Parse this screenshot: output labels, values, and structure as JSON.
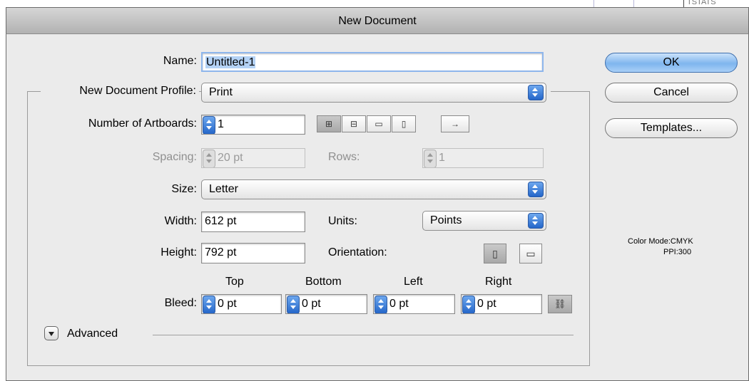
{
  "dialog": {
    "title": "New Document"
  },
  "background": {
    "corner_text": "TSTATS"
  },
  "name": {
    "label": "Name:",
    "value": "Untitled-1"
  },
  "profile": {
    "label": "New Document Profile:",
    "value": "Print"
  },
  "artboards": {
    "label": "Number of Artboards:",
    "value": "1",
    "layout_icons": [
      "grid-by-row-icon",
      "grid-by-column-icon",
      "arrange-by-row-icon",
      "arrange-by-column-icon",
      "left-to-right-icon"
    ]
  },
  "spacing": {
    "label": "Spacing:",
    "value": "20 pt"
  },
  "rows": {
    "label": "Rows:",
    "value": "1"
  },
  "size": {
    "label": "Size:",
    "value": "Letter"
  },
  "width": {
    "label": "Width:",
    "value": "612 pt"
  },
  "height": {
    "label": "Height:",
    "value": "792 pt"
  },
  "units": {
    "label": "Units:",
    "value": "Points"
  },
  "orientation": {
    "label": "Orientation:",
    "selected": "portrait"
  },
  "bleed": {
    "label": "Bleed:",
    "top": {
      "label": "Top",
      "value": "0 pt"
    },
    "bottom": {
      "label": "Bottom",
      "value": "0 pt"
    },
    "left": {
      "label": "Left",
      "value": "0 pt"
    },
    "right": {
      "label": "Right",
      "value": "0 pt"
    }
  },
  "advanced": {
    "label": "Advanced"
  },
  "buttons": {
    "ok": "OK",
    "cancel": "Cancel",
    "templates": "Templates..."
  },
  "info": {
    "color_mode": "Color Mode:CMYK",
    "ppi": "PPI:300"
  },
  "colors": {
    "accent": "#3f7fd9",
    "dialog_bg": "#ebebeb"
  }
}
